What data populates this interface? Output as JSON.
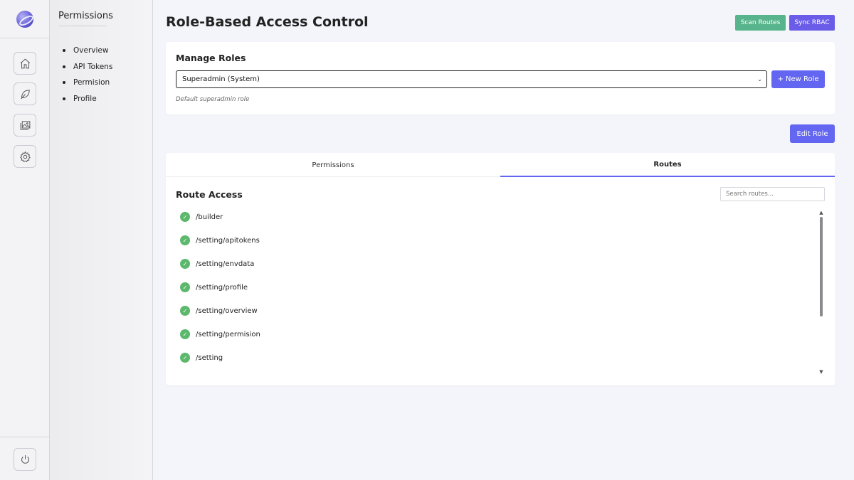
{
  "icons": {
    "logo": "planet-logo-icon",
    "home": "home-icon",
    "leaf": "leaf-icon",
    "gallery": "image-gallery-icon",
    "settings": "gear-icon",
    "power": "power-icon",
    "check": "check-circle-icon",
    "select_chevron": "chevron-down-icon"
  },
  "subnav": {
    "title": "Permissions",
    "items": [
      "Overview",
      "API Tokens",
      "Permision",
      "Profile"
    ]
  },
  "header": {
    "title": "Role-Based Access Control",
    "scan_label": "Scan Routes",
    "sync_label": "Sync RBAC"
  },
  "roles": {
    "title": "Manage Roles",
    "selected": "Superadmin (System)",
    "new_role_label": "+ New Role",
    "description": "Default superadmin role",
    "edit_label": "Edit Role"
  },
  "tabs": [
    {
      "label": "Permissions",
      "active": false
    },
    {
      "label": "Routes",
      "active": true
    }
  ],
  "routes": {
    "title": "Route Access",
    "search_placeholder": "Search routes...",
    "items": [
      "/builder",
      "/setting/apitokens",
      "/setting/envdata",
      "/setting/profile",
      "/setting/overview",
      "/setting/permision",
      "/setting"
    ]
  },
  "colors": {
    "scan": "#58b48c",
    "sync": "#6a5ce8",
    "primary": "#6366f1",
    "check": "#5cb86c"
  }
}
